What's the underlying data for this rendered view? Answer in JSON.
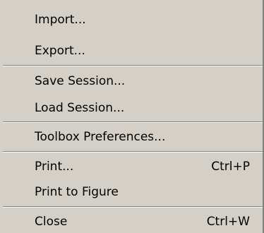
{
  "menu": {
    "items": [
      {
        "label": "Import...",
        "shortcut": ""
      },
      {
        "label": "Export...",
        "shortcut": ""
      },
      {
        "label": "Save Session...",
        "shortcut": ""
      },
      {
        "label": "Load Session...",
        "shortcut": ""
      },
      {
        "label": "Toolbox Preferences...",
        "shortcut": ""
      },
      {
        "label": "Print...",
        "shortcut": "Ctrl+P"
      },
      {
        "label": "Print to Figure",
        "shortcut": ""
      },
      {
        "label": "Close",
        "shortcut": "Ctrl+W"
      }
    ]
  },
  "colors": {
    "menu_background": "#d4d0c8",
    "separator_shadow": "#808080",
    "separator_highlight": "#ffffff"
  }
}
